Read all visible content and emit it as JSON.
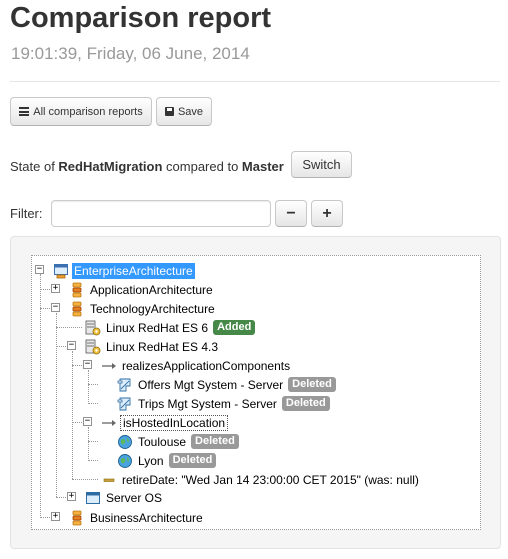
{
  "page": {
    "title": "Comparison report",
    "timestamp": "19:01:39, Friday, 06 June, 2014"
  },
  "toolbar": {
    "all_reports_label": "All comparison reports",
    "save_label": "Save"
  },
  "state": {
    "prefix": "State of ",
    "source": "RedHatMigration",
    "middle": " compared to ",
    "target": "Master",
    "switch_label": "Switch"
  },
  "filter": {
    "label": "Filter:",
    "value": "",
    "placeholder": "",
    "minus_label": "−",
    "plus_label": "+"
  },
  "colors": {
    "selected_bg": "#3399ff",
    "added_badge": "#468847",
    "deleted_badge": "#999999"
  },
  "tree": {
    "root": {
      "label": "EnterpriseArchitecture",
      "icon": "enterprise-architecture-icon",
      "toggle": "−"
    },
    "application": {
      "label": "ApplicationArchitecture",
      "icon": "layer-stack-icon",
      "toggle": "+"
    },
    "technology": {
      "label": "TechnologyArchitecture",
      "icon": "layer-stack-icon",
      "toggle": "−"
    },
    "linux6": {
      "label": "Linux RedHat ES 6",
      "icon": "server-gear-icon",
      "badge": "Added"
    },
    "linux43": {
      "label": "Linux RedHat ES 4.3",
      "icon": "server-gear-icon",
      "toggle": "−"
    },
    "realizes": {
      "label": "realizesApplicationComponents",
      "icon": "relation-arrow-icon",
      "toggle": "−"
    },
    "offers": {
      "label": "Offers Mgt System - Server",
      "icon": "app-component-icon",
      "badge": "Deleted"
    },
    "trips": {
      "label": "Trips Mgt System - Server",
      "icon": "app-component-icon",
      "badge": "Deleted"
    },
    "hosted": {
      "label": "isHostedInLocation",
      "icon": "relation-arrow-icon",
      "toggle": "−"
    },
    "toulouse": {
      "label": "Toulouse",
      "icon": "location-globe-icon",
      "badge": "Deleted"
    },
    "lyon": {
      "label": "Lyon",
      "icon": "location-globe-icon",
      "badge": "Deleted"
    },
    "retire": {
      "label": "retireDate: \"Wed Jan 14 23:00:00 CET 2015\" (was: null)",
      "icon": "attribute-dash-icon"
    },
    "serveros": {
      "label": "Server OS",
      "icon": "window-icon",
      "toggle": "+"
    },
    "business": {
      "label": "BusinessArchitecture",
      "icon": "layer-stack-icon",
      "toggle": "+"
    }
  }
}
